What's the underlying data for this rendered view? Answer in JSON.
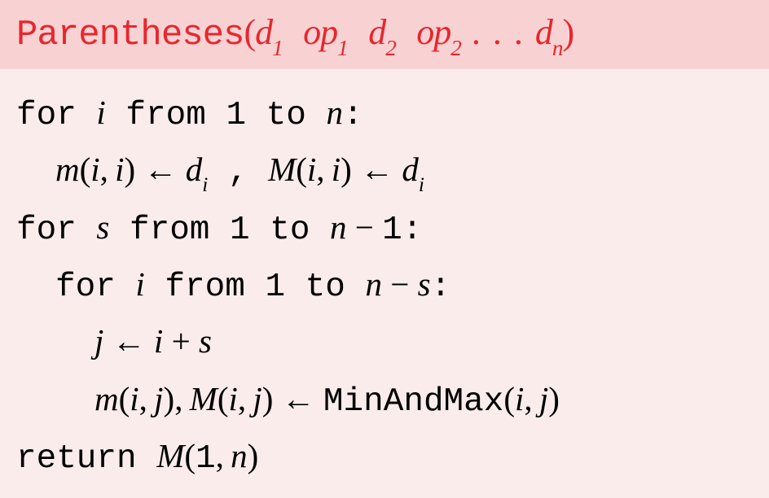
{
  "header": {
    "func_name": "Parentheses",
    "open": "(",
    "close": ")",
    "d": "d",
    "op": "op",
    "s1": "1",
    "s2": "2",
    "sn": "n",
    "dots": " . . . "
  },
  "lines": {
    "l1": {
      "for": "for ",
      "i": "i",
      "from": " from ",
      "one": "1",
      "to": " to ",
      "n": "n",
      "colon": ":"
    },
    "l2": {
      "m": "m",
      "open": "(",
      "i": "i",
      "comma1": ", ",
      "i2": "i",
      "close": ")",
      "arrow": " ← ",
      "d": "d",
      "si": "i",
      "sep": " ,  ",
      "M": "M",
      "open2": "(",
      "i3": "i",
      "comma2": ", ",
      "i4": "i",
      "close2": ")",
      "arrow2": " ← ",
      "d2": "d",
      "si2": "i"
    },
    "l3": {
      "for": "for ",
      "s": "s",
      "from": " from ",
      "one": "1",
      "to": " to ",
      "n": "n",
      "minus": " − ",
      "one2": "1",
      "colon": ":"
    },
    "l4": {
      "for": "for ",
      "i": "i",
      "from": " from ",
      "one": "1",
      "to": " to ",
      "n": "n",
      "minus": " − ",
      "s": "s",
      "colon": ":"
    },
    "l5": {
      "j": "j",
      "arrow": " ← ",
      "i": "i",
      "plus": " + ",
      "s": "s"
    },
    "l6": {
      "m": "m",
      "open": "(",
      "i": "i",
      "comma1": ", ",
      "j": "j",
      "close": ")",
      "sep": ", ",
      "M": "M",
      "open2": "(",
      "i2": "i",
      "comma2": ", ",
      "j2": "j",
      "close2": ")",
      "arrow": " ← ",
      "fn": "MinAndMax",
      "open3": "(",
      "i3": "i",
      "comma3": ", ",
      "j3": "j",
      "close3": ")"
    },
    "l7": {
      "ret": "return ",
      "M": "M",
      "open": "(",
      "one": "1",
      "comma": ", ",
      "n": "n",
      "close": ")"
    }
  }
}
